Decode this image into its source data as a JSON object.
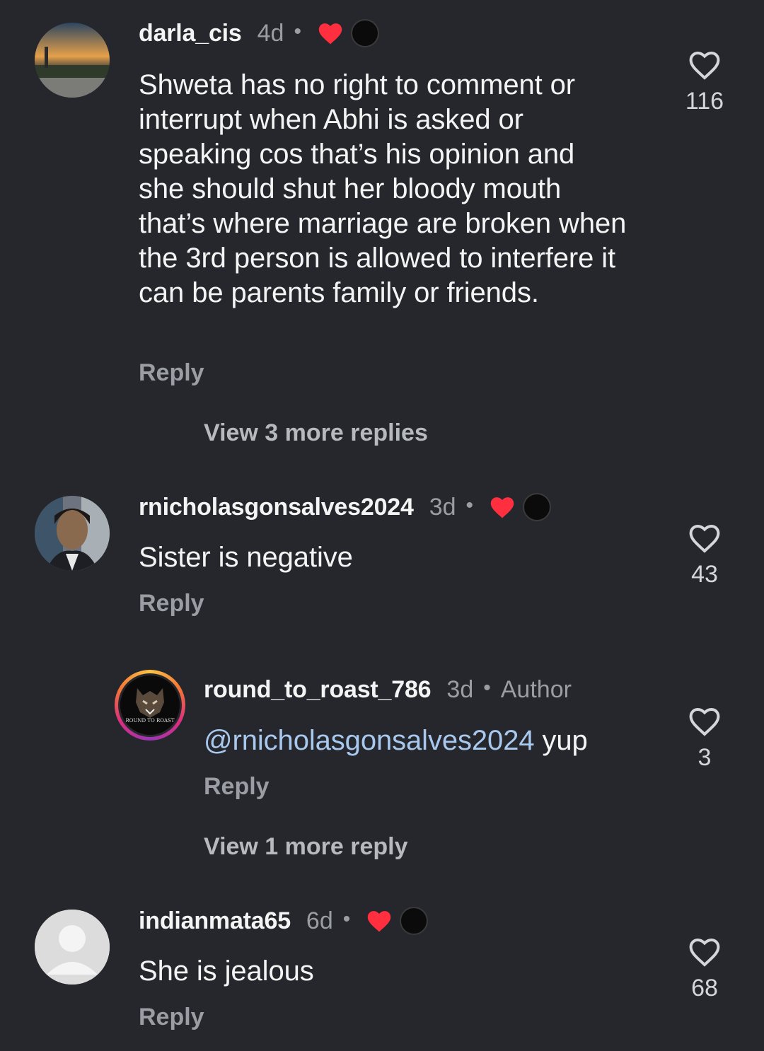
{
  "comments": [
    {
      "username": "darla_cis",
      "time": "4d",
      "dot": "•",
      "text": "Shweta has no right to comment or interrupt when Abhi is asked or speaking cos that’s his opinion and she should shut her bloody mouth that’s where marriage are broken when the 3rd person is allowed to interfere it can be parents family or friends.",
      "reply_label": "Reply",
      "like_count": "116",
      "view_more": "View 3 more replies",
      "liked_by_creator": true
    },
    {
      "username": "rnicholasgonsalves2024",
      "time": "3d",
      "dot": "•",
      "text": "Sister is negative",
      "reply_label": "Reply",
      "like_count": "43",
      "liked_by_creator": true
    },
    {
      "username": "round_to_roast_786",
      "time": "3d",
      "dot": "•",
      "author_tag": "Author",
      "mention": "@rnicholasgonsalves2024",
      "text": " yup",
      "reply_label": "Reply",
      "like_count": "3",
      "view_more": "View 1 more reply",
      "avatar_caption": "ROUND TO ROAST"
    },
    {
      "username": "indianmata65",
      "time": "6d",
      "dot": "•",
      "text": "She is jealous",
      "reply_label": "Reply",
      "like_count": "68",
      "liked_by_creator": true
    }
  ],
  "icons": {
    "like": "heart-outline-icon",
    "creator_like": "red-heart-icon",
    "creator_badge": "creator-avatar-badge"
  },
  "colors": {
    "background": "#25272c",
    "text": "#f4f4f4",
    "muted": "#9a9da3",
    "mention": "#a9c8ee",
    "heart_red": "#ff2f40"
  }
}
